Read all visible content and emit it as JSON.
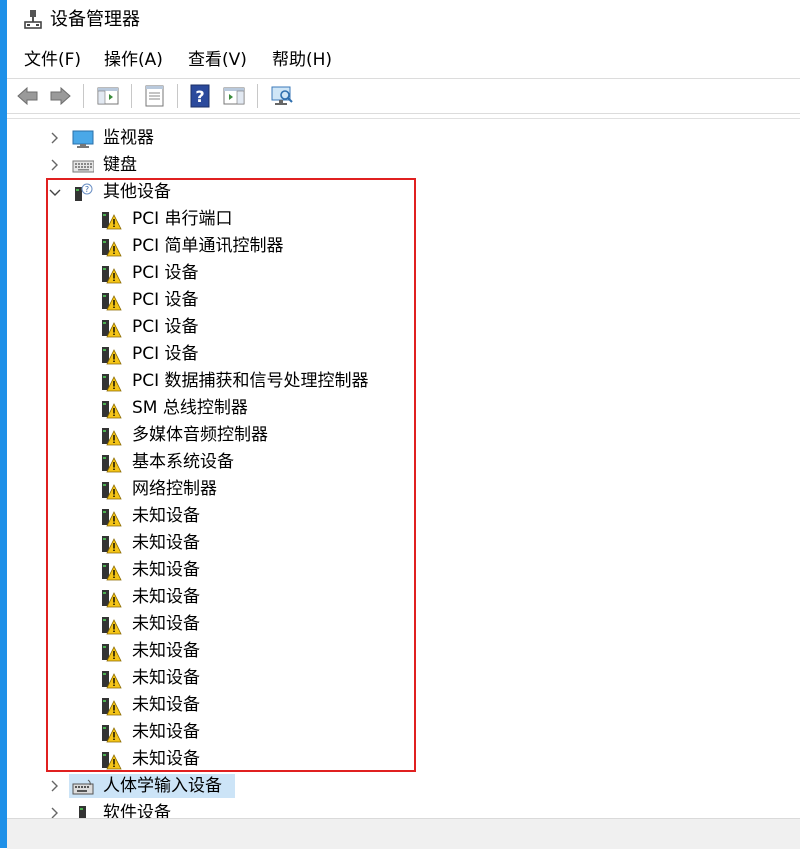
{
  "window": {
    "title": "设备管理器",
    "title_icon": "device-manager-icon"
  },
  "menu": [
    {
      "label": "文件(F)"
    },
    {
      "label": "操作(A)"
    },
    {
      "label": "查看(V)"
    },
    {
      "label": "帮助(H)"
    }
  ],
  "toolbar": {
    "buttons": [
      "back-icon",
      "forward-icon",
      "show-hide-console-tree-icon",
      "properties-icon",
      "help-icon",
      "action-pane-icon",
      "scan-hardware-icon"
    ]
  },
  "tree": {
    "monitors": {
      "label": "监视器"
    },
    "keyboards": {
      "label": "键盘"
    },
    "other_devices": {
      "label": "其他设备",
      "children": [
        {
          "label": "PCI 串行端口"
        },
        {
          "label": "PCI 简单通讯控制器"
        },
        {
          "label": "PCI 设备"
        },
        {
          "label": "PCI 设备"
        },
        {
          "label": "PCI 设备"
        },
        {
          "label": "PCI 设备"
        },
        {
          "label": "PCI 数据捕获和信号处理控制器"
        },
        {
          "label": "SM 总线控制器"
        },
        {
          "label": "多媒体音频控制器"
        },
        {
          "label": "基本系统设备"
        },
        {
          "label": "网络控制器"
        },
        {
          "label": "未知设备"
        },
        {
          "label": "未知设备"
        },
        {
          "label": "未知设备"
        },
        {
          "label": "未知设备"
        },
        {
          "label": "未知设备"
        },
        {
          "label": "未知设备"
        },
        {
          "label": "未知设备"
        },
        {
          "label": "未知设备"
        },
        {
          "label": "未知设备"
        },
        {
          "label": "未知设备"
        }
      ]
    },
    "hid": {
      "label": "人体学输入设备",
      "selected": true
    },
    "software_devices": {
      "label": "软件设备"
    }
  },
  "colors": {
    "selection": "#cce4f7",
    "highlight_border": "#e02020",
    "accent": "#1e90e8"
  }
}
